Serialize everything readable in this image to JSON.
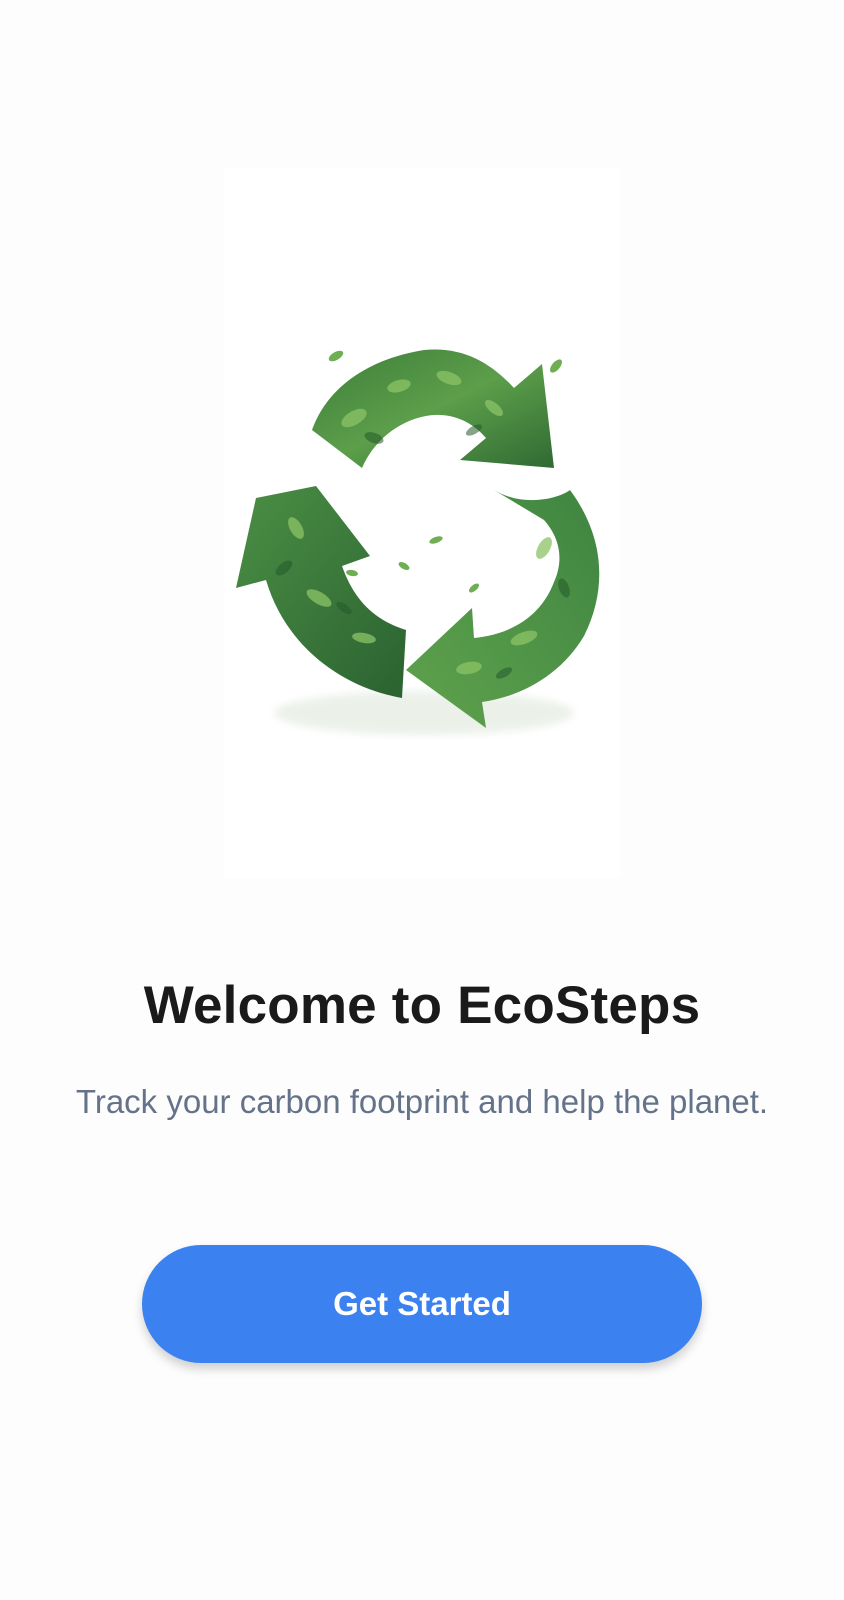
{
  "welcome": {
    "illustration": "recycle-leaves-icon",
    "title": "Welcome to EcoSteps",
    "subtitle": "Track your carbon footprint and help the planet.",
    "cta_label": "Get Started"
  },
  "colors": {
    "background": "#fdfdfd",
    "title": "#1a1a1a",
    "subtitle": "#64738a",
    "button": "#3b82f0",
    "button_text": "#ffffff",
    "leaf_dark": "#2f6e34",
    "leaf_mid": "#4a8f43",
    "leaf_light": "#7db857"
  }
}
